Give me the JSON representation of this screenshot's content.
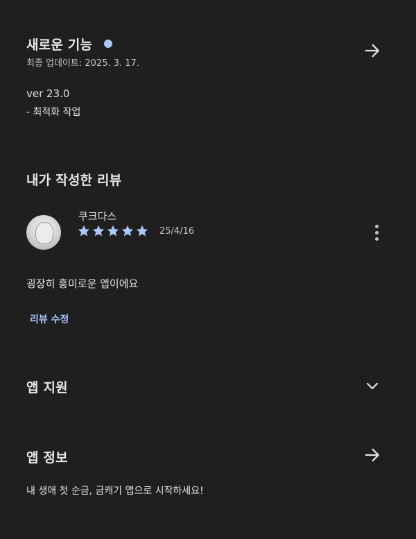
{
  "whats_new": {
    "title": "새로운 기능",
    "last_updated": "최종 업데이트: 2025. 3. 17.",
    "version": "ver 23.0",
    "note": "- 최적화 작업"
  },
  "my_review": {
    "title": "내가 작성한 리뷰",
    "reviewer_name": "쿠크다스",
    "rating": 5,
    "date": "25/4/16",
    "text": "굉장히 흥미로운 앱이에요",
    "edit_label": "리뷰 수정"
  },
  "app_support": {
    "title": "앱 지원"
  },
  "app_info": {
    "title": "앱 정보",
    "description": "내 생애 첫 순금, 금캐기 앱으로 시작하세요!"
  },
  "colors": {
    "background": "#1f1f1f",
    "accent": "#a8c7fa",
    "text_primary": "#e3e3e3",
    "text_secondary": "#c4c7c5"
  },
  "icons": {
    "whats_new_arrow": "arrow-right-icon",
    "more": "more-vert-icon",
    "support_toggle": "chevron-down-icon",
    "app_info_arrow": "arrow-right-icon",
    "star": "star-icon"
  }
}
